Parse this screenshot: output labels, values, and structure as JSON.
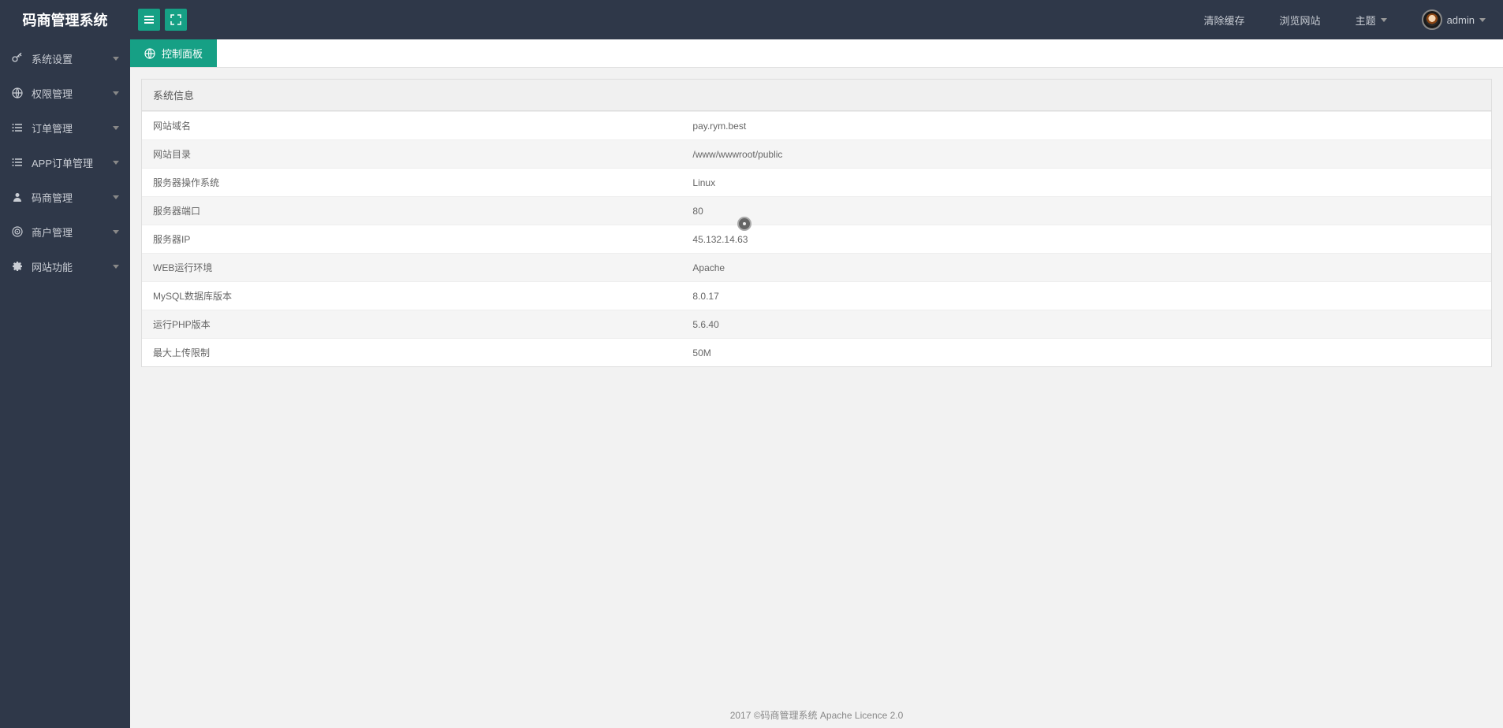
{
  "app": {
    "title": "码商管理系统"
  },
  "header": {
    "clear_cache": "清除缓存",
    "browse_site": "浏览网站",
    "theme": "主题",
    "username": "admin"
  },
  "sidebar": {
    "items": [
      {
        "label": "系统设置",
        "icon": "key"
      },
      {
        "label": "权限管理",
        "icon": "globe"
      },
      {
        "label": "订单管理",
        "icon": "list"
      },
      {
        "label": "APP订单管理",
        "icon": "list"
      },
      {
        "label": "码商管理",
        "icon": "user"
      },
      {
        "label": "商户管理",
        "icon": "target"
      },
      {
        "label": "网站功能",
        "icon": "gear"
      }
    ]
  },
  "tabs": {
    "active": {
      "label": "控制面板"
    }
  },
  "panel": {
    "title": "系统信息",
    "rows": [
      {
        "label": "网站域名",
        "value": "pay.rym.best"
      },
      {
        "label": "网站目录",
        "value": "/www/wwwroot/public"
      },
      {
        "label": "服务器操作系统",
        "value": "Linux"
      },
      {
        "label": "服务器端口",
        "value": "80"
      },
      {
        "label": "服务器IP",
        "value": "45.132.14.63"
      },
      {
        "label": "WEB运行环境",
        "value": "Apache"
      },
      {
        "label": "MySQL数据库版本",
        "value": "8.0.17"
      },
      {
        "label": "运行PHP版本",
        "value": "5.6.40"
      },
      {
        "label": "最大上传限制",
        "value": "50M"
      }
    ]
  },
  "footer": {
    "text": "2017 ©码商管理系统 Apache Licence 2.0"
  }
}
